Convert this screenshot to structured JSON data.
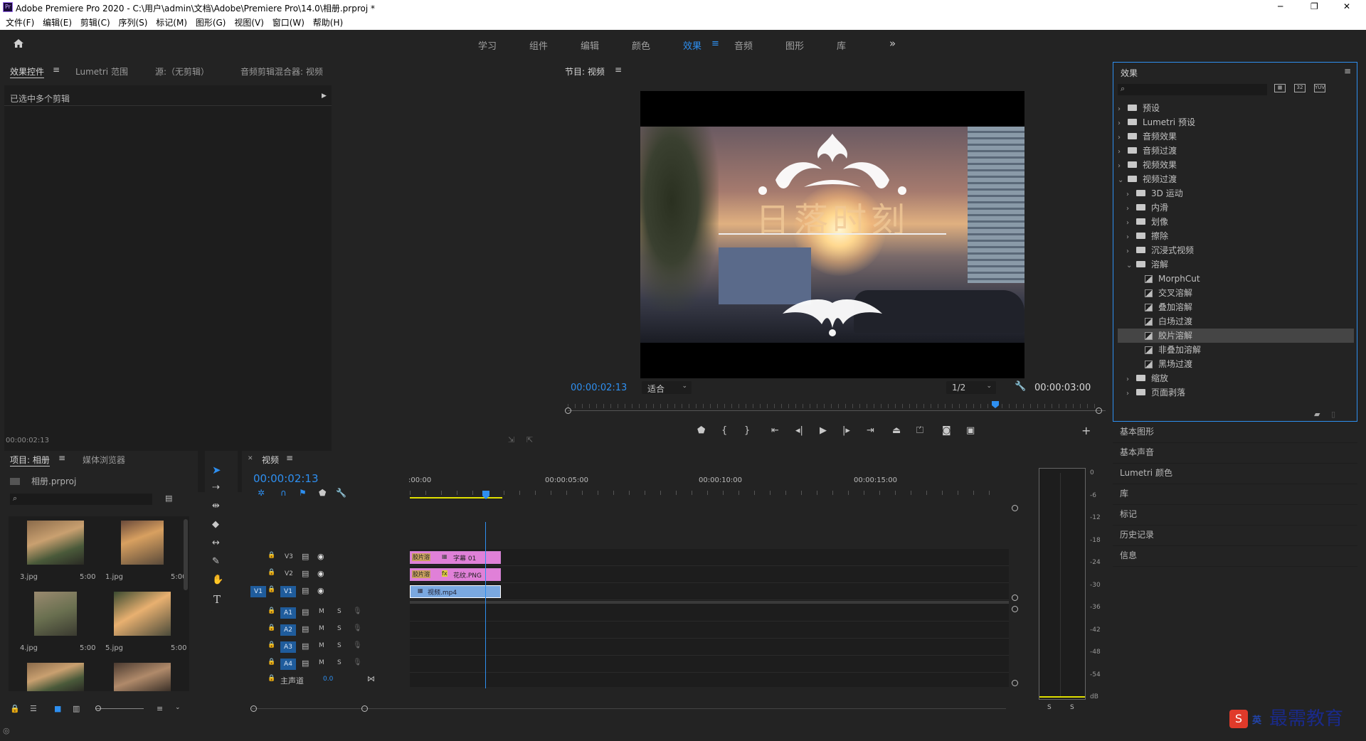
{
  "window": {
    "title": "Adobe Premiere Pro 2020 - C:\\用户\\admin\\文档\\Adobe\\Premiere Pro\\14.0\\相册.prproj *",
    "min": "─",
    "max": "❐",
    "close": "✕"
  },
  "menu": [
    "文件(F)",
    "编辑(E)",
    "剪辑(C)",
    "序列(S)",
    "标记(M)",
    "图形(G)",
    "视图(V)",
    "窗口(W)",
    "帮助(H)"
  ],
  "workspaces": [
    "学习",
    "组件",
    "编辑",
    "颜色",
    "效果",
    "音频",
    "图形",
    "库"
  ],
  "workspace_active": "效果",
  "source_panel": {
    "tabs": [
      "效果控件",
      "Lumetri 范围",
      "源:（无剪辑）",
      "音频剪辑混合器: 视频"
    ],
    "message": "已选中多个剪辑",
    "timecode": "00:00:02:13"
  },
  "program": {
    "title": "节目: 视频",
    "overlay_text": "日落时刻",
    "timecode": "00:00:02:13",
    "fit": "适合",
    "resolution": "1/2",
    "duration": "00:00:03:00"
  },
  "effects": {
    "title": "效果",
    "tree": [
      {
        "label": "预设",
        "level": 0,
        "type": "folder",
        "open": false
      },
      {
        "label": "Lumetri 预设",
        "level": 0,
        "type": "folder",
        "open": false
      },
      {
        "label": "音频效果",
        "level": 0,
        "type": "folder",
        "open": false
      },
      {
        "label": "音频过渡",
        "level": 0,
        "type": "folder",
        "open": false
      },
      {
        "label": "视频效果",
        "level": 0,
        "type": "folder",
        "open": false
      },
      {
        "label": "视频过渡",
        "level": 0,
        "type": "folder",
        "open": true
      },
      {
        "label": "3D 运动",
        "level": 1,
        "type": "folder",
        "open": false
      },
      {
        "label": "内滑",
        "level": 1,
        "type": "folder",
        "open": false
      },
      {
        "label": "划像",
        "level": 1,
        "type": "folder",
        "open": false
      },
      {
        "label": "擦除",
        "level": 1,
        "type": "folder",
        "open": false
      },
      {
        "label": "沉浸式视频",
        "level": 1,
        "type": "folder",
        "open": false
      },
      {
        "label": "溶解",
        "level": 1,
        "type": "folder",
        "open": true
      },
      {
        "label": "MorphCut",
        "level": 2,
        "type": "fx"
      },
      {
        "label": "交叉溶解",
        "level": 2,
        "type": "fx"
      },
      {
        "label": "叠加溶解",
        "level": 2,
        "type": "fx"
      },
      {
        "label": "白场过渡",
        "level": 2,
        "type": "fx"
      },
      {
        "label": "胶片溶解",
        "level": 2,
        "type": "fx",
        "selected": true
      },
      {
        "label": "非叠加溶解",
        "level": 2,
        "type": "fx"
      },
      {
        "label": "黑场过渡",
        "level": 2,
        "type": "fx"
      },
      {
        "label": "缩放",
        "level": 1,
        "type": "folder",
        "open": false
      },
      {
        "label": "页面剥落",
        "level": 1,
        "type": "folder",
        "open": false
      }
    ]
  },
  "side_panels": [
    "基本图形",
    "基本声音",
    "Lumetri 颜色",
    "库",
    "标记",
    "历史记录",
    "信息"
  ],
  "project": {
    "tabs": [
      "项目: 相册",
      "媒体浏览器"
    ],
    "file": "相册.prproj",
    "items": [
      {
        "name": "3.jpg",
        "dur": "5:00"
      },
      {
        "name": "1.jpg",
        "dur": "5:00"
      },
      {
        "name": "4.jpg",
        "dur": "5:00"
      },
      {
        "name": "5.jpg",
        "dur": "5:00"
      }
    ]
  },
  "timeline": {
    "tab": "视频",
    "timecode": "00:00:02:13",
    "ruler": [
      ":00:00",
      "00:00:05:00",
      "00:00:10:00",
      "00:00:15:00"
    ],
    "video_tracks": [
      "V3",
      "V2",
      "V1"
    ],
    "audio_tracks": [
      "A1",
      "A2",
      "A3",
      "A4"
    ],
    "src_patch": "V1",
    "master": "主声道",
    "master_val": "0.0",
    "clips": [
      {
        "track": "V3",
        "label": "字幕 01",
        "tag": "胶片溶"
      },
      {
        "track": "V2",
        "label": "花纹.PNG",
        "tag": "胶片溶"
      },
      {
        "track": "V1",
        "label": "视频.mp4"
      }
    ]
  },
  "meter": {
    "scale": [
      "0",
      "-6",
      "-12",
      "-18",
      "-24",
      "-30",
      "-36",
      "-42",
      "-48",
      "-54",
      "dB"
    ],
    "ch": [
      "S",
      "S"
    ]
  },
  "watermark": {
    "text": "最需教育",
    "ime": "英"
  }
}
